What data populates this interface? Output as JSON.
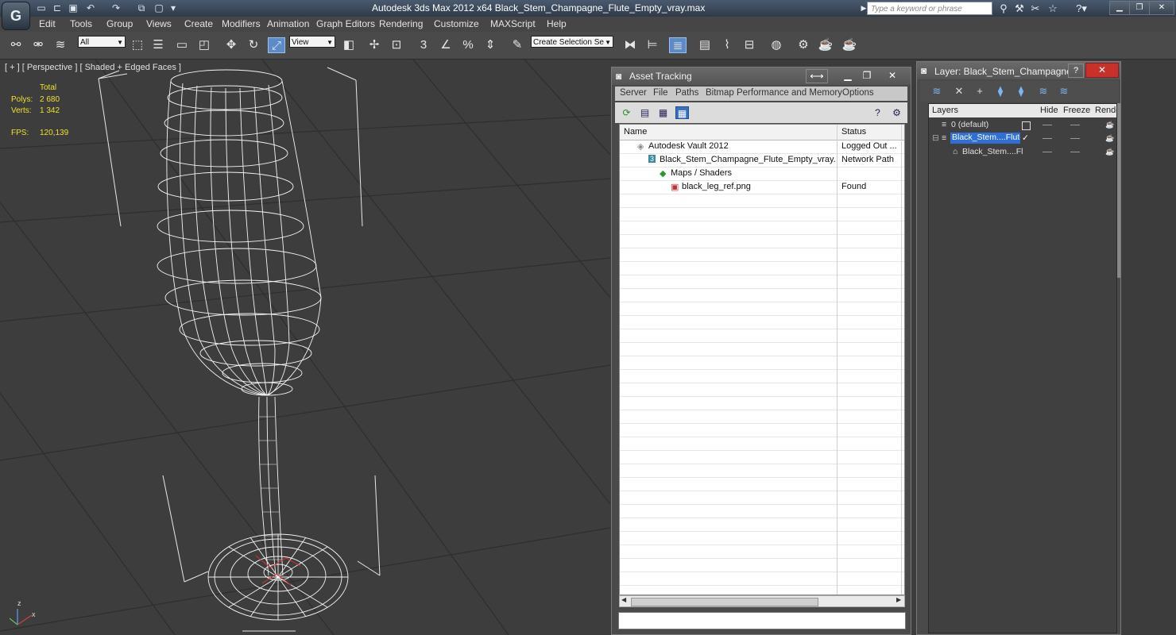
{
  "app": {
    "title": "Autodesk 3ds Max  2012 x64      Black_Stem_Champagne_Flute_Empty_vray.max",
    "search_placeholder": "Type a keyword or phrase",
    "logo_letter": "G"
  },
  "menu": [
    "Edit",
    "Tools",
    "Group",
    "Views",
    "Create",
    "Modifiers",
    "Animation",
    "Graph Editors",
    "Rendering",
    "Customize",
    "MAXScript",
    "Help"
  ],
  "toolbar": {
    "selection_filter": "All",
    "ref_coord": "View",
    "named_selection": "Create Selection Se"
  },
  "viewport": {
    "label": "[ + ] [ Perspective ] [ Shaded + Edged Faces ]",
    "stats": {
      "total_label": "Total",
      "polys_label": "Polys:",
      "polys_value": "2 680",
      "verts_label": "Verts:",
      "verts_value": "1 342",
      "fps_label": "FPS:",
      "fps_value": "120,139"
    },
    "axis_x": "x",
    "axis_z": "z"
  },
  "asset_tracking": {
    "title": "Asset Tracking",
    "menu": [
      "Server",
      "File",
      "Paths",
      "Bitmap Performance and Memory",
      "Options"
    ],
    "columns": {
      "name": "Name",
      "status": "Status"
    },
    "rows": [
      {
        "name": "Autodesk Vault 2012",
        "status": "Logged Out ..."
      },
      {
        "name": "Black_Stem_Champagne_Flute_Empty_vray.m...",
        "status": "Network Path"
      },
      {
        "name": "Maps / Shaders",
        "status": ""
      },
      {
        "name": "black_leg_ref.png",
        "status": "Found"
      }
    ]
  },
  "layer_window": {
    "title": "Layer: Black_Stem_Champagne_F...",
    "columns": {
      "layers": "Layers",
      "hide": "Hide",
      "freeze": "Freeze",
      "render": "Rende"
    },
    "rows": [
      {
        "name": "0 (default)"
      },
      {
        "name": "Black_Stem....Flute"
      },
      {
        "name": "Black_Stem....Flu"
      }
    ]
  },
  "colors": {
    "accent": "#5b8cc8",
    "selection": "#2f6fd6",
    "stats": "#f0e030"
  }
}
